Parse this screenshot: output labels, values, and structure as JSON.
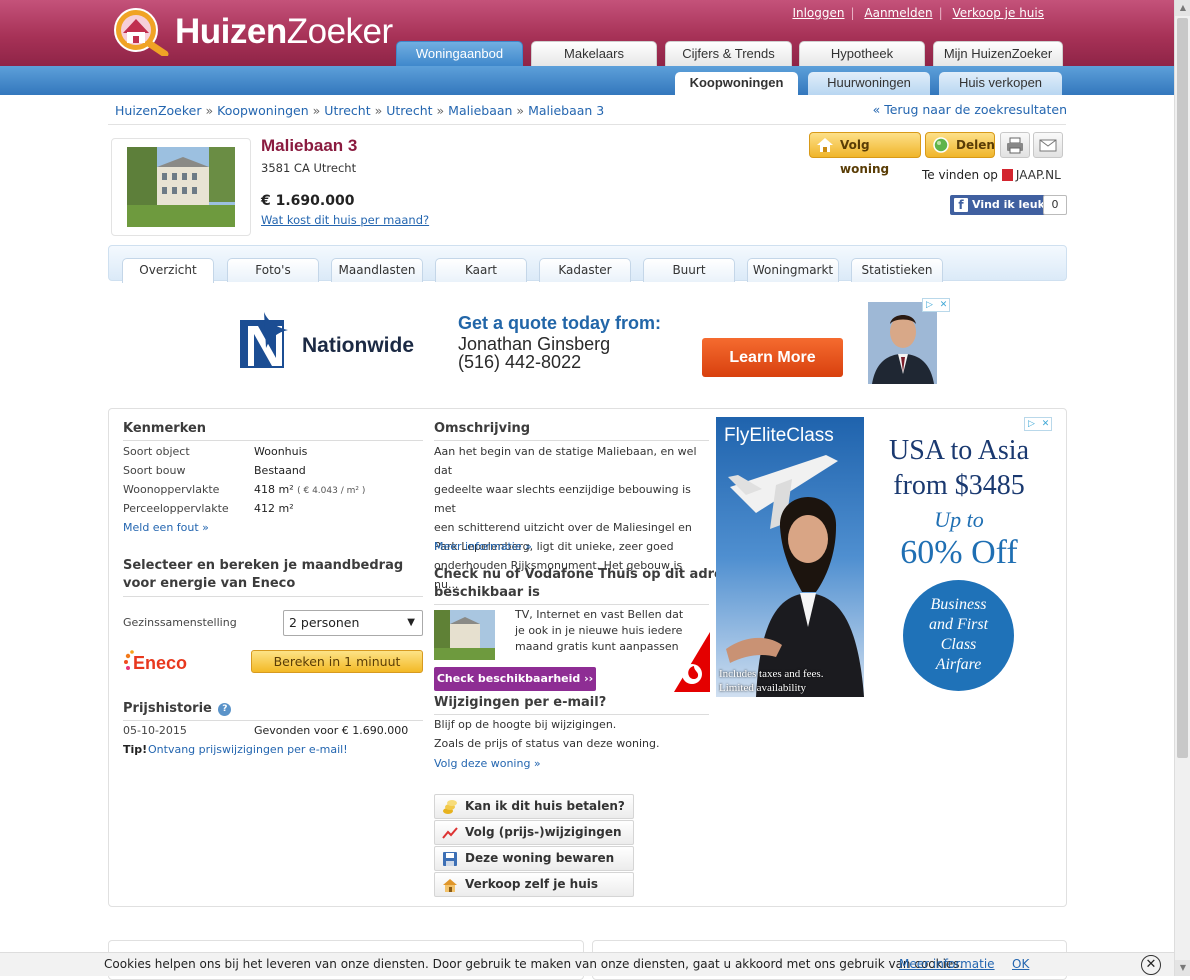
{
  "brand": {
    "name_bold": "Huizen",
    "name_light": "Zoeker"
  },
  "toplinks": [
    "Inloggen",
    "Aanmelden",
    "Verkoop je huis"
  ],
  "main_tabs": [
    "Woningaanbod",
    "Makelaars",
    "Cijfers & Trends",
    "Hypotheek",
    "Mijn HuizenZoeker"
  ],
  "sub_tabs": [
    "Koopwoningen",
    "Huurwoningen",
    "Huis verkopen"
  ],
  "breadcrumb": [
    "HuizenZoeker",
    "Koopwoningen",
    "Utrecht",
    "Utrecht",
    "Maliebaan",
    "Maliebaan 3"
  ],
  "breadcrumb_sep": "»",
  "back_link": "« Terug naar de zoekresultaten",
  "property": {
    "title": "Maliebaan 3",
    "address": "3581 CA Utrecht",
    "price": "€ 1.690.000",
    "cost_link": "Wat kost dit huis per maand?"
  },
  "actions": {
    "follow": "Volg woning",
    "share": "Delen"
  },
  "found_on": {
    "label": "Te vinden op",
    "site": "JAAP.NL"
  },
  "facebook": {
    "like": "Vind ik leuk",
    "count": "0",
    "icon": "f"
  },
  "property_tabs": [
    "Overzicht",
    "Foto's",
    "Maandlasten",
    "Kaart",
    "Kadaster",
    "Buurt",
    "Woningmarkt",
    "Statistieken"
  ],
  "ad_top": {
    "brand": "Nationwide",
    "line1": "Get a quote today from:",
    "line2": "Jonathan Ginsberg",
    "line3": "(516) 442-8022",
    "cta": "Learn More"
  },
  "kenmerken": {
    "title": "Kenmerken",
    "rows": [
      {
        "label": "Soort object",
        "value": "Woonhuis"
      },
      {
        "label": "Soort bouw",
        "value": "Bestaand"
      },
      {
        "label": "Woonoppervlakte",
        "value": "418 m²",
        "extra": "( € 4.043 / m² )"
      },
      {
        "label": "Perceeloppervlakte",
        "value": "412 m²"
      }
    ],
    "report_link": "Meld een fout »"
  },
  "energy": {
    "title_1": "Selecteer en bereken je maandbedrag",
    "title_2": "voor energie van Eneco",
    "household_label": "Gezinssamenstelling",
    "household_value": "2 personen",
    "brand": "Eneco",
    "button": "Bereken in 1 minuut"
  },
  "price_history": {
    "title": "Prijshistorie",
    "help": "?",
    "rows": [
      {
        "date": "05-10-2015",
        "event": "Gevonden voor € 1.690.000"
      }
    ],
    "tip_label": "Tip!",
    "tip_link": "Ontvang prijswijzigingen per e-mail!"
  },
  "description": {
    "title": "Omschrijving",
    "lines": [
      "Aan het begin van de statige Maliebaan, en wel dat",
      "gedeelte waar slechts eenzijdige bebouwing is met",
      "een schitterend uitzicht over de Maliesingel en",
      "Park Lepelenberg, ligt dit unieke, zeer goed",
      "onderhouden Rijksmonument. Het gebouw is nu..."
    ],
    "more": "Meer informatie »"
  },
  "vodafone": {
    "title_1": "Check nu of Vodafone Thuis op dit adres",
    "title_2": "beschikbaar is",
    "lines": [
      "TV, Internet en vast Bellen dat",
      "je ook in je nieuwe huis iedere",
      "maand gratis kunt aanpassen"
    ],
    "button": "Check beschikbaarheid ››"
  },
  "email_updates": {
    "title": "Wijzigingen per e-mail?",
    "lines": [
      "Blijf op de hoogte bij wijzigingen.",
      "Zoals de prijs of status van deze woning."
    ],
    "link": "Volg deze woning »"
  },
  "action_buttons": [
    "Kan ik dit huis betalen?",
    "Volg (prijs-)wijzigingen",
    "Deze woning bewaren",
    "Verkoop zelf je huis"
  ],
  "ad_side": {
    "brand": "FlyEliteClass",
    "headline_1": "USA to Asia",
    "headline_2": "from $3485",
    "upto": "Up to",
    "off": "60% Off",
    "circle_lines": [
      "Business",
      "and First",
      "Class",
      "Airfare"
    ],
    "fine_1": "Includes taxes and fees.",
    "fine_2": "Limited availability"
  },
  "cookie": {
    "message": "Cookies helpen ons bij het leveren van onze diensten. Door gebruik te maken van onze diensten, gaat u akkoord met ons gebruik van cookies.",
    "more": "Meer informatie",
    "ok": "OK",
    "close": "✕"
  },
  "colors": {
    "header": "#a73257",
    "subbar": "#3f88cc",
    "accent_title": "#8a1b3f",
    "link": "#2466b0"
  }
}
